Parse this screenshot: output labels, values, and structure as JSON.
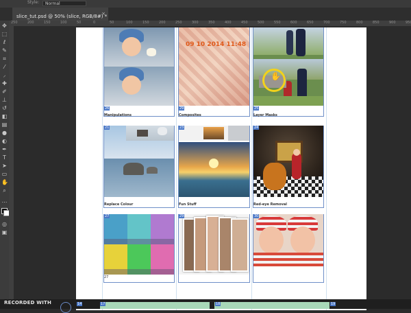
{
  "tab": {
    "title": "slice_tut.psd @ 50% (slice, RGB/8#) *",
    "close": "×"
  },
  "optbar": {
    "style_label": "Style:",
    "style_value": "Normal"
  },
  "ruler": {
    "ticks": [
      "250",
      "200",
      "150",
      "100",
      "50",
      "0",
      "50",
      "100",
      "150",
      "200",
      "250",
      "300",
      "350",
      "400",
      "450",
      "500",
      "550",
      "600",
      "650",
      "700",
      "750",
      "800",
      "850",
      "900",
      "950"
    ]
  },
  "tools": [
    "move-tool",
    "marquee-tool",
    "lasso-tool",
    "quick-select-tool",
    "crop-tool",
    "slice-tool",
    "eyedropper-tool",
    "healing-tool",
    "brush-tool",
    "clone-stamp-tool",
    "history-brush-tool",
    "eraser-tool",
    "gradient-tool",
    "blur-tool",
    "dodge-tool",
    "pen-tool",
    "type-tool",
    "path-select-tool",
    "shape-tool",
    "hand-tool",
    "zoom-tool"
  ],
  "cells": [
    {
      "num": "26",
      "caption": "Manipulations"
    },
    {
      "num": "29",
      "caption": "Composites"
    },
    {
      "num": "25",
      "caption": "Layer Masks"
    },
    {
      "num": "21",
      "caption": "Replace Colour"
    },
    {
      "num": "23",
      "caption": "Fun Stuff"
    },
    {
      "num": "24",
      "caption": "Red-eye Removal"
    },
    {
      "num": "27",
      "caption": ""
    },
    {
      "num": "29",
      "caption": ""
    },
    {
      "num": "30",
      "caption": ""
    }
  ],
  "photo_texts": {
    "datestamp": "09 10 2014 11:48"
  },
  "bottom": {
    "left_num": "14",
    "mid_num": "17",
    "mid2_num": "18",
    "right_num": "19"
  },
  "watermark": {
    "text": "RECORDED WITH"
  },
  "colors": {
    "slice_blue": "#4a78c8",
    "cursor_yellow": "#f2d21b",
    "strip_green": "#a8d8b8"
  }
}
